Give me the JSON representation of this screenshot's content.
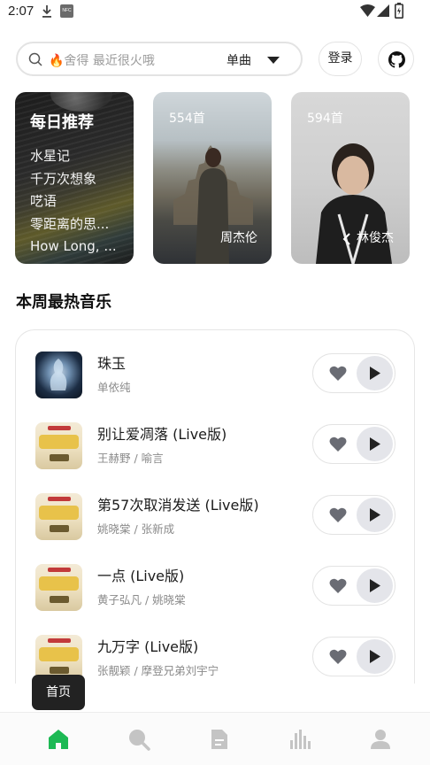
{
  "status_bar": {
    "time": "2:07",
    "icons": [
      "download-icon",
      "nfc-icon",
      "wifi-icon",
      "signal-icon",
      "battery-icon"
    ],
    "nfc_label": "NFC"
  },
  "header": {
    "search_placeholder": "🔥舍得 最近很火哦",
    "search_type": "单曲",
    "login_label": "登录",
    "github_icon": "github-icon"
  },
  "cards": {
    "daily": {
      "title": "每日推荐",
      "items": [
        "水星记",
        "千万次想象",
        "呓语",
        "零距离的思...",
        "How Long, ..."
      ]
    },
    "jay": {
      "count": "554首",
      "artist": "周杰伦"
    },
    "jj": {
      "count": "594首",
      "artist": "林俊杰"
    }
  },
  "section": {
    "title": "本周最热音乐"
  },
  "songs": [
    {
      "title": "珠玉",
      "artist": "单依纯",
      "cover": "blue-figure"
    },
    {
      "title": "别让爱凋落 (Live版)",
      "artist": "王赫野 / 喻言",
      "cover": "show-poster"
    },
    {
      "title": "第57次取消发送 (Live版)",
      "artist": "姚晓棠 / 张新成",
      "cover": "show-poster"
    },
    {
      "title": "一点 (Live版)",
      "artist": "黄子弘凡 / 姚晓棠",
      "cover": "show-poster"
    },
    {
      "title": "九万字 (Live版)",
      "artist": "张靓颖 / 摩登兄弟刘宇宁",
      "cover": "show-poster"
    }
  ],
  "tooltip": {
    "label": "首页"
  },
  "bottom_nav": {
    "items": [
      "home-icon",
      "search-icon",
      "document-icon",
      "chart-icon",
      "user-icon"
    ],
    "active_color": "#1db954",
    "inactive_color": "#c4c4c4"
  },
  "colors": {
    "accent": "#1db954",
    "play_bg": "#e4e5ea",
    "border": "#e3e3e3"
  }
}
